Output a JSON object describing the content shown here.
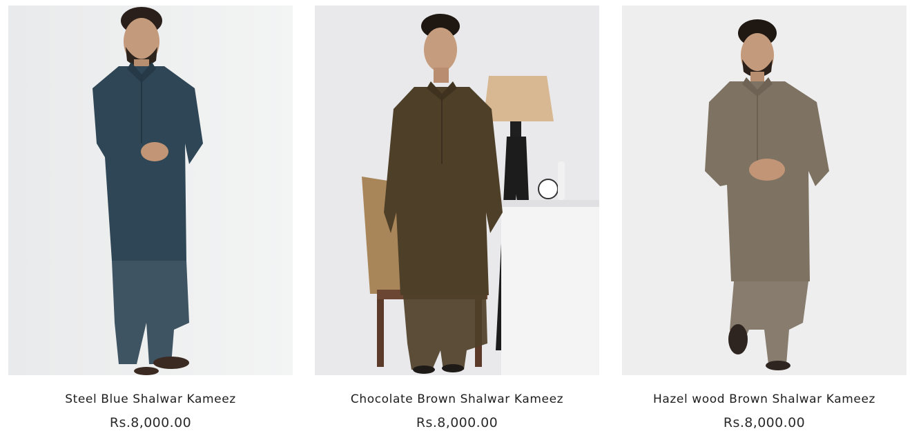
{
  "products": [
    {
      "name": "Steel Blue Shalwar Kameez",
      "price": "Rs.8,000.00",
      "image_alt": "Model wearing steel blue shalwar kameez",
      "color": "#2f4656"
    },
    {
      "name": "Chocolate Brown Shalwar Kameez",
      "price": "Rs.8,000.00",
      "image_alt": "Model wearing chocolate brown shalwar kameez",
      "color": "#4e3f28"
    },
    {
      "name": "Hazel wood Brown Shalwar Kameez",
      "price": "Rs.8,000.00",
      "image_alt": "Model wearing hazel wood brown shalwar kameez",
      "color": "#7e7262"
    }
  ]
}
